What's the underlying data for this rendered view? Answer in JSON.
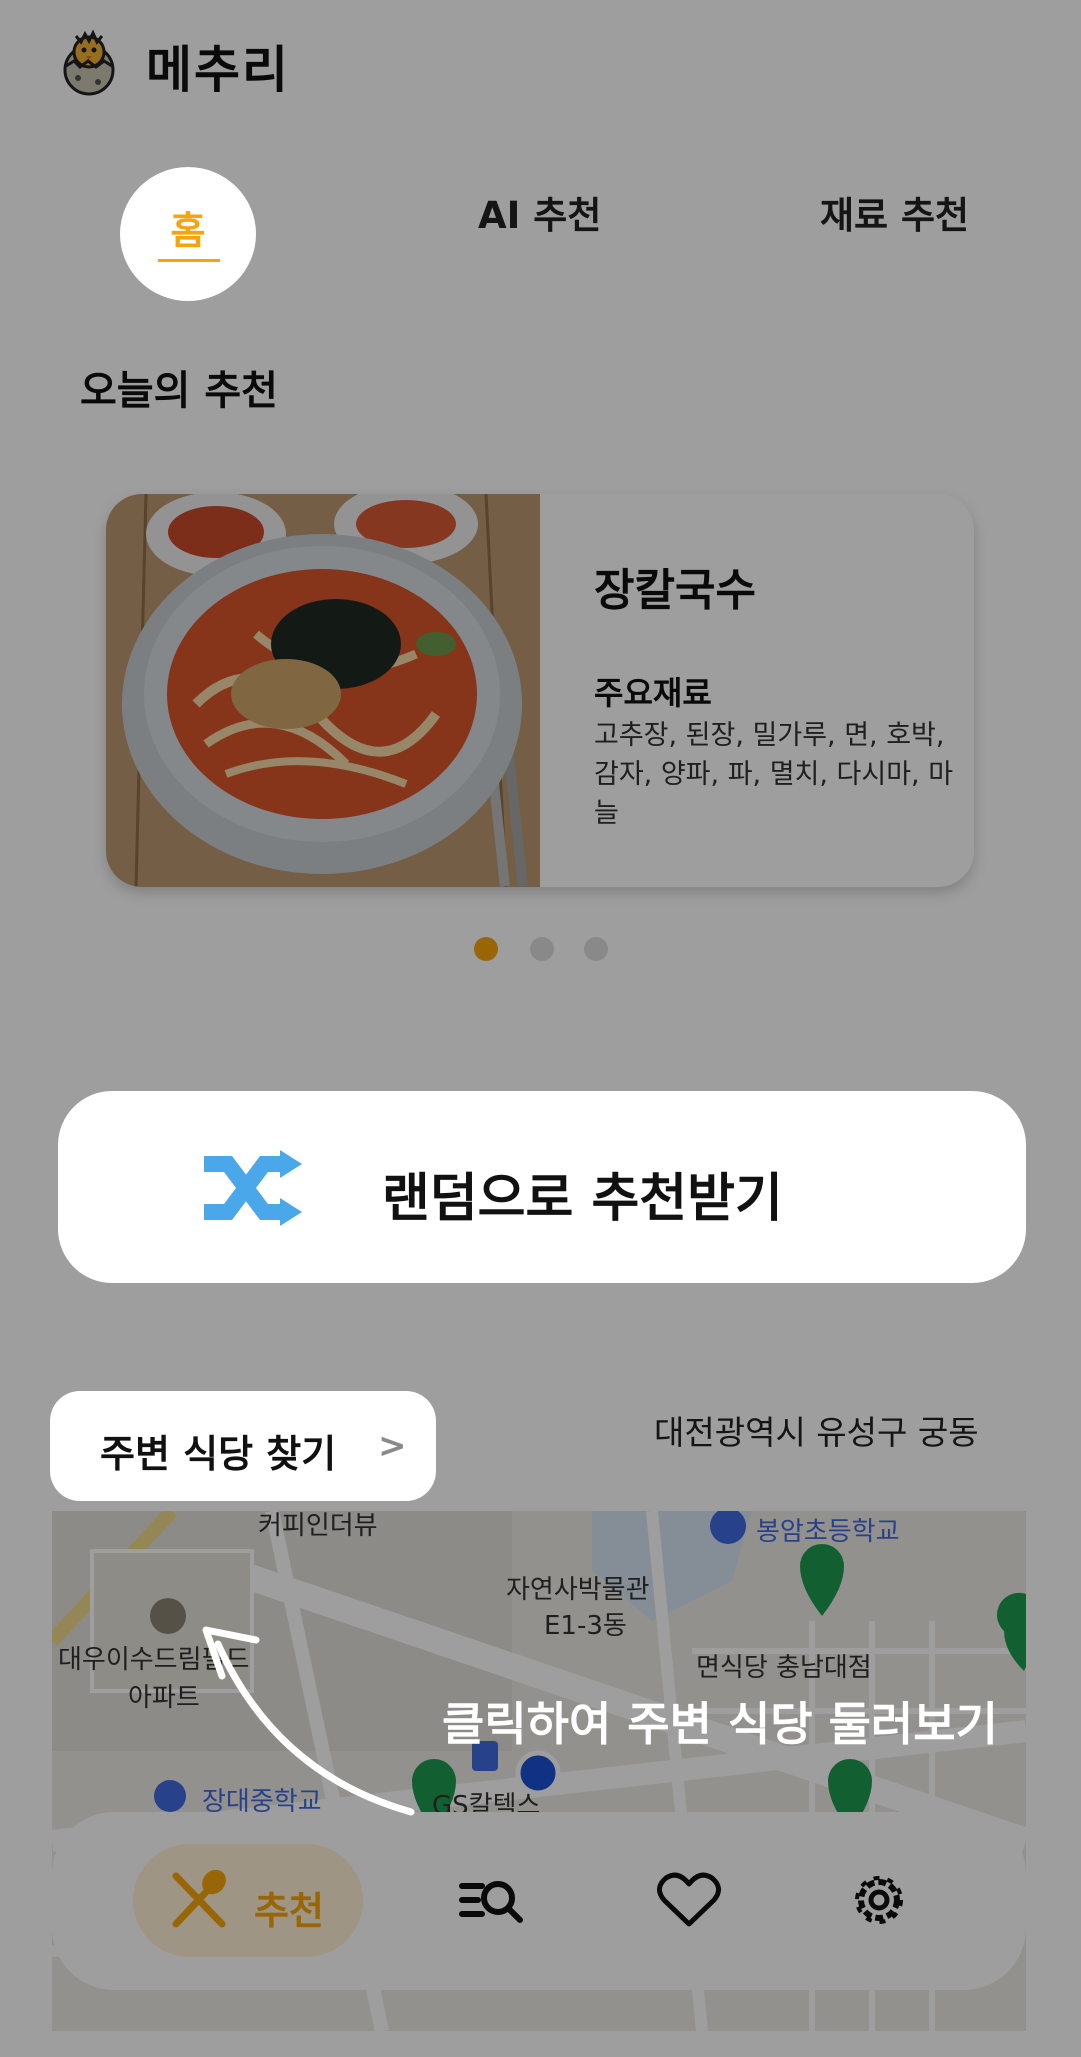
{
  "header": {
    "title": "메추리",
    "logo_icon": "chick-in-egg-icon"
  },
  "tabs": [
    {
      "label": "홈"
    },
    {
      "label": "AI 추천"
    },
    {
      "label": "재료 추천"
    }
  ],
  "today": {
    "section_title": "오늘의 추천",
    "card": {
      "dish_name": "장칼국수",
      "ingredients_label": "주요재료",
      "ingredients": "고추장, 된장, 밀가루, 면, 호박, 감자, 양파, 파, 멸치, 다시마, 마늘"
    },
    "carousel": {
      "current": 1,
      "total": 3
    }
  },
  "random_button": {
    "label": "랜덤으로 추천받기",
    "icon": "shuffle-icon"
  },
  "nearby": {
    "button_label": "주변 식당 찾기",
    "arrow": ">",
    "location": "대전광역시 유성구 궁동"
  },
  "map": {
    "labels": [
      "커피인더뷰",
      "봉암초등학교",
      "자연사박물관",
      "E1-3동",
      "대우이수드림필드",
      "아파트",
      "면식당 충남대점",
      "장대중학교",
      "GS칼텍스"
    ]
  },
  "hint": {
    "text": "클릭하여 주변 식당 둘러보기"
  },
  "bottom_nav": {
    "recommend_label": "추천",
    "items": [
      "recommend",
      "search",
      "favorites",
      "settings"
    ]
  },
  "colors": {
    "accent": "#f5a40c",
    "shuffle": "#4aa8ea",
    "pin": "#1e9b4f",
    "dim": "rgba(0,0,0,0.38)"
  }
}
